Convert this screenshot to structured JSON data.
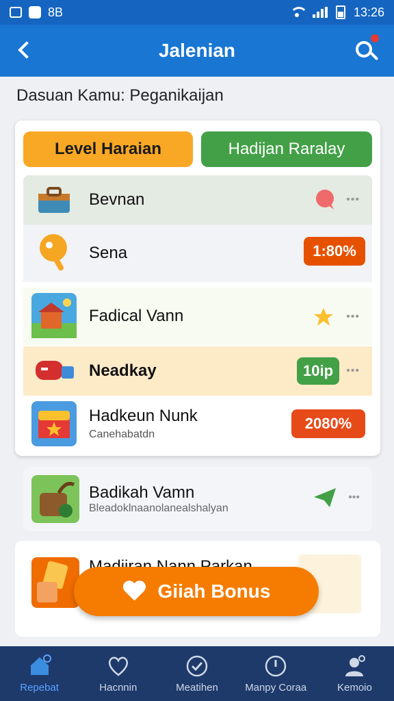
{
  "status_bar": {
    "left_text": "8B",
    "time": "13:26"
  },
  "app_bar": {
    "title": "Jalenian"
  },
  "subtitle": "Dasuan Kamu: Peganikaijan",
  "tabs": [
    {
      "label": "Level Haraian",
      "color": "#f9a825"
    },
    {
      "label": "Hadijan Raralay",
      "color": "#43a047"
    }
  ],
  "rows": [
    {
      "name": "Bevnan",
      "icon": "toolbox-icon",
      "badge": ""
    },
    {
      "name": "Sena",
      "icon": "lollipop-icon",
      "badge": "1:80%"
    },
    {
      "name": "Fadical Vann",
      "icon": "house-icon",
      "badge": ""
    },
    {
      "name": "Neadkay",
      "icon": "mailbox-icon",
      "badge": "10ip"
    },
    {
      "name": "Hadkeun Nunk",
      "subtitle": "Canehabatdn",
      "icon": "treasure-chest-icon",
      "badge": "2080%"
    }
  ],
  "list": [
    {
      "name": "Badikah Vamn",
      "subtitle": "Bleadoklnaanolanealshalyan",
      "icon": "barrel-icon"
    },
    {
      "name": "Madiiran Nann Parkan",
      "icon": "tiles-icon"
    }
  ],
  "cta": {
    "label": "Giiah Bonus"
  },
  "bottom_nav": [
    {
      "label": "Repebat",
      "icon": "home-icon",
      "active": true
    },
    {
      "label": "Hacnnin",
      "icon": "heart-icon",
      "active": false
    },
    {
      "label": "Meatihen",
      "icon": "check-circle-icon",
      "active": false
    },
    {
      "label": "Manpy Coraa",
      "icon": "clock-icon",
      "active": false
    },
    {
      "label": "Kemoio",
      "icon": "profile-icon",
      "active": false
    }
  ],
  "colors": {
    "primary": "#1976d2",
    "accent": "#f57c00",
    "nav_bg": "#1e3a6b"
  }
}
